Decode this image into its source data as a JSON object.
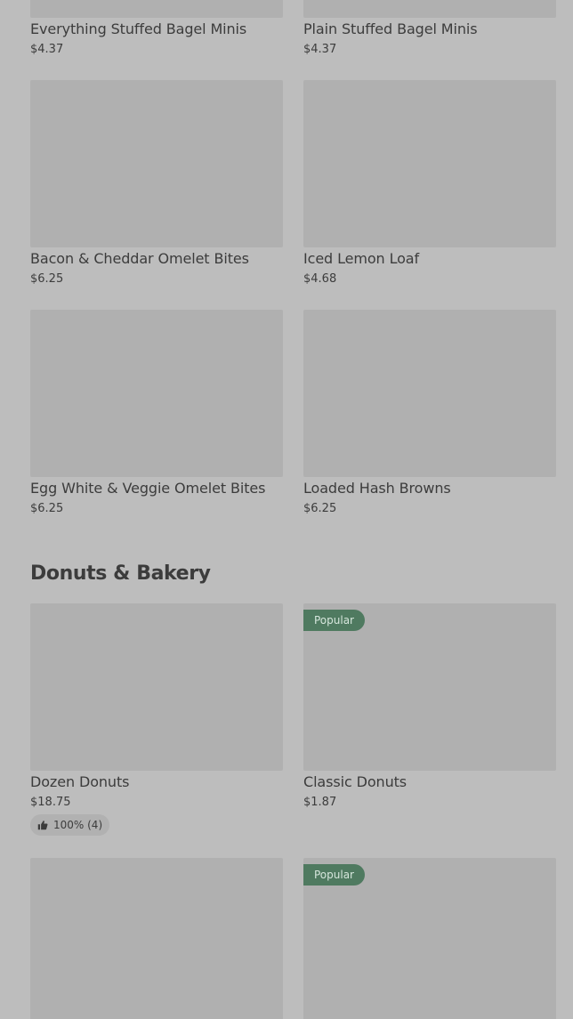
{
  "sections": [
    {
      "items": [
        {
          "name": "Everything Stuffed Bagel Minis",
          "price": "$4.37"
        },
        {
          "name": "Plain Stuffed Bagel Minis",
          "price": "$4.37"
        },
        {
          "name": "Bacon & Cheddar Omelet Bites",
          "price": "$6.25"
        },
        {
          "name": "Iced Lemon Loaf",
          "price": "$4.68"
        },
        {
          "name": "Egg White & Veggie Omelet Bites",
          "price": "$6.25"
        },
        {
          "name": "Loaded Hash Browns",
          "price": "$6.25"
        }
      ]
    },
    {
      "title": "Donuts & Bakery",
      "items": [
        {
          "name": "Dozen Donuts",
          "price": "$18.75",
          "rating": "100% (4)"
        },
        {
          "name": "Classic Donuts",
          "price": "$1.87",
          "badge": "Popular"
        },
        {
          "badge": "Popular"
        }
      ]
    }
  ],
  "colors": {
    "background": "#bdbdbd",
    "image_placeholder": "#b0b0b0",
    "popular_badge": "#4f7a60"
  },
  "icons": {
    "rating": "thumbs-up-icon"
  }
}
